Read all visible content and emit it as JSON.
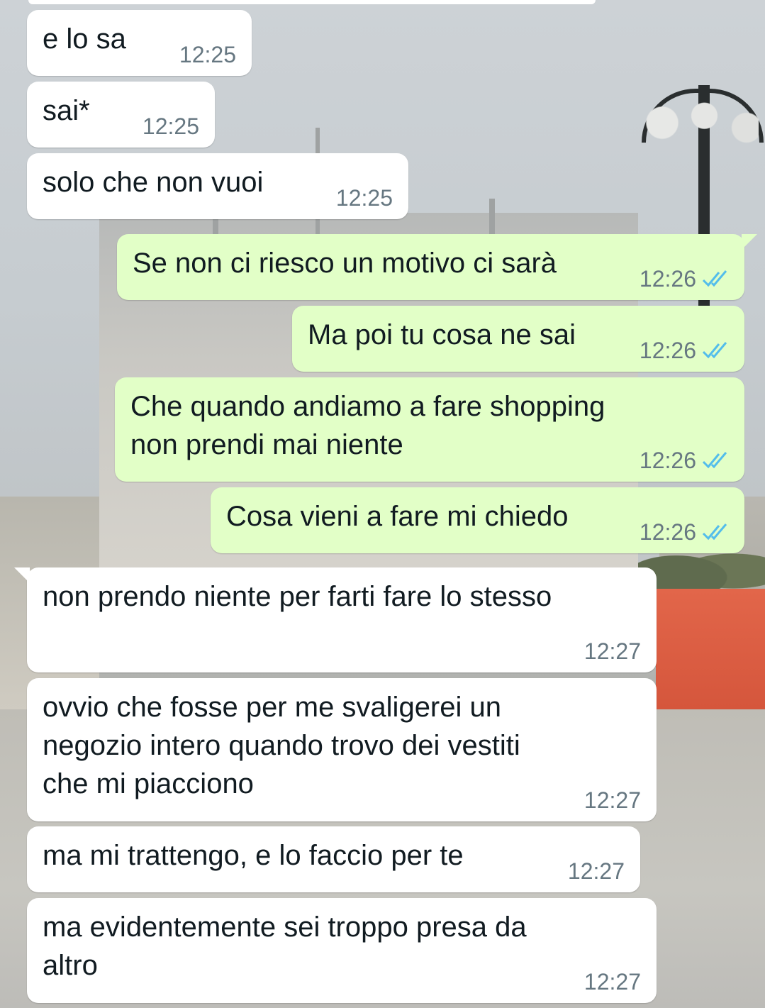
{
  "colors": {
    "incoming_bubble": "#ffffff",
    "outgoing_bubble": "#e2ffc7",
    "timestamp": "#667781",
    "read_ticks": "#53bdeb"
  },
  "messages": [
    {
      "direction": "in",
      "text": "e lo sa",
      "time": "12:25"
    },
    {
      "direction": "in",
      "text": "sai*",
      "time": "12:25"
    },
    {
      "direction": "in",
      "text": "solo che non vuoi",
      "time": "12:25"
    },
    {
      "direction": "out",
      "text": "Se non ci riesco un motivo ci sarà",
      "time": "12:26",
      "status_icon": "double-check-read-icon"
    },
    {
      "direction": "out",
      "text": "Ma poi tu cosa ne sai",
      "time": "12:26",
      "status_icon": "double-check-read-icon"
    },
    {
      "direction": "out",
      "text": "Che quando andiamo a fare shopping\nnon prendi mai niente",
      "time": "12:26",
      "status_icon": "double-check-read-icon"
    },
    {
      "direction": "out",
      "text": "Cosa vieni a fare mi chiedo",
      "time": "12:26",
      "status_icon": "double-check-read-icon"
    },
    {
      "direction": "in",
      "text": "non prendo niente per farti fare lo stesso",
      "time": "12:27"
    },
    {
      "direction": "in",
      "text": "ovvio che fosse per me svaligerei un\nnegozio intero quando trovo dei vestiti\nche mi piacciono",
      "time": "12:27"
    },
    {
      "direction": "in",
      "text": "ma mi trattengo, e lo faccio per te",
      "time": "12:27"
    },
    {
      "direction": "in",
      "text": "ma evidentemente sei troppo presa da\naltro",
      "time": "12:27"
    }
  ]
}
